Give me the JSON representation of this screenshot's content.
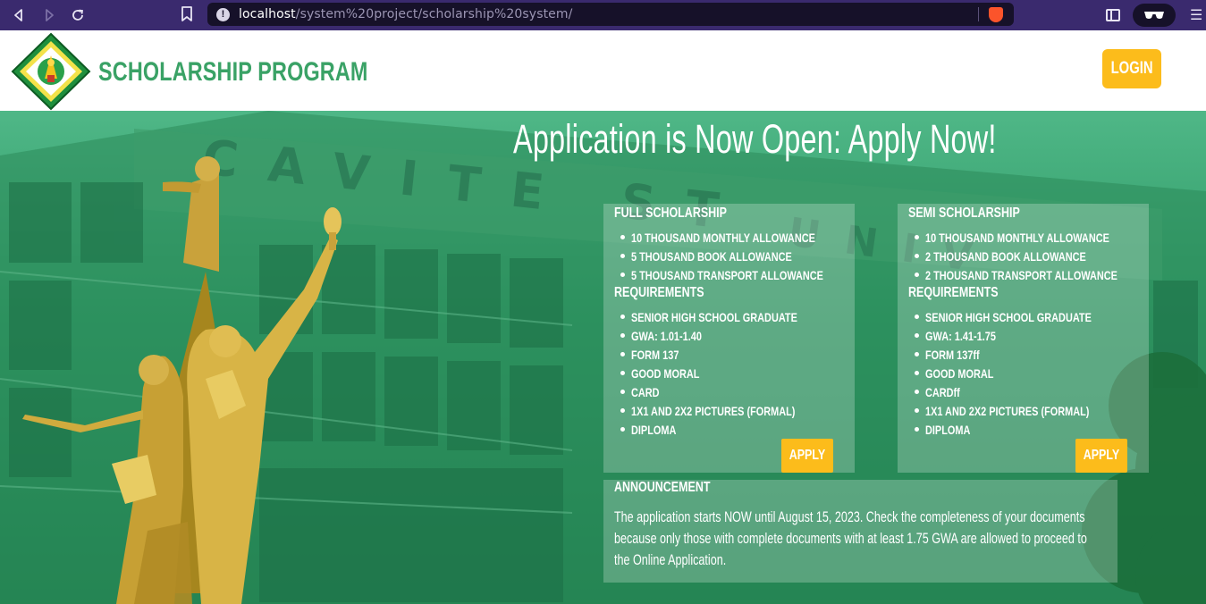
{
  "browser": {
    "url_host": "localhost",
    "url_path": "/system%20project/scholarship%20system/"
  },
  "header": {
    "title": "SCHOLARSHIP PROGRAM",
    "login_label": "LOGIN"
  },
  "hero": {
    "title": "Application is Now Open: Apply Now!",
    "building_sign": "CAVITE STATE UNIVERSITY"
  },
  "full": {
    "heading": "FULL SCHOLARSHIP",
    "benefits": [
      "10 THOUSAND MONTHLY ALLOWANCE",
      "5 THOUSAND BOOK ALLOWANCE",
      "5 THOUSAND TRANSPORT ALLOWANCE"
    ],
    "req_heading": "REQUIREMENTS",
    "requirements": [
      "SENIOR HIGH SCHOOL GRADUATE",
      "GWA: 1.01-1.40",
      "FORM 137",
      "GOOD MORAL",
      "CARD",
      "1X1 AND 2X2 PICTURES (FORMAL)",
      "DIPLOMA"
    ],
    "apply_label": "APPLY"
  },
  "semi": {
    "heading": "SEMI SCHOLARSHIP",
    "benefits": [
      "10 THOUSAND MONTHLY ALLOWANCE",
      "2 THOUSAND BOOK ALLOWANCE",
      "2 THOUSAND TRANSPORT ALLOWANCE"
    ],
    "req_heading": "REQUIREMENTS",
    "requirements": [
      "SENIOR HIGH SCHOOL GRADUATE",
      "GWA: 1.41-1.75",
      "FORM 137ff",
      "GOOD MORAL",
      "CARDff",
      "1X1 AND 2X2 PICTURES (FORMAL)",
      "DIPLOMA"
    ],
    "apply_label": "APPLY"
  },
  "announcement": {
    "heading": "ANNOUNCEMENT",
    "body": "The application starts NOW until August 15, 2023. Check the completeness of your documents because only those with complete documents with at least 1.75 GWA are allowed to proceed to the Online Application."
  },
  "colors": {
    "brand_green": "#3aa266",
    "accent_yellow": "#fcbc1b",
    "browser_frame": "#3a2a6e"
  }
}
